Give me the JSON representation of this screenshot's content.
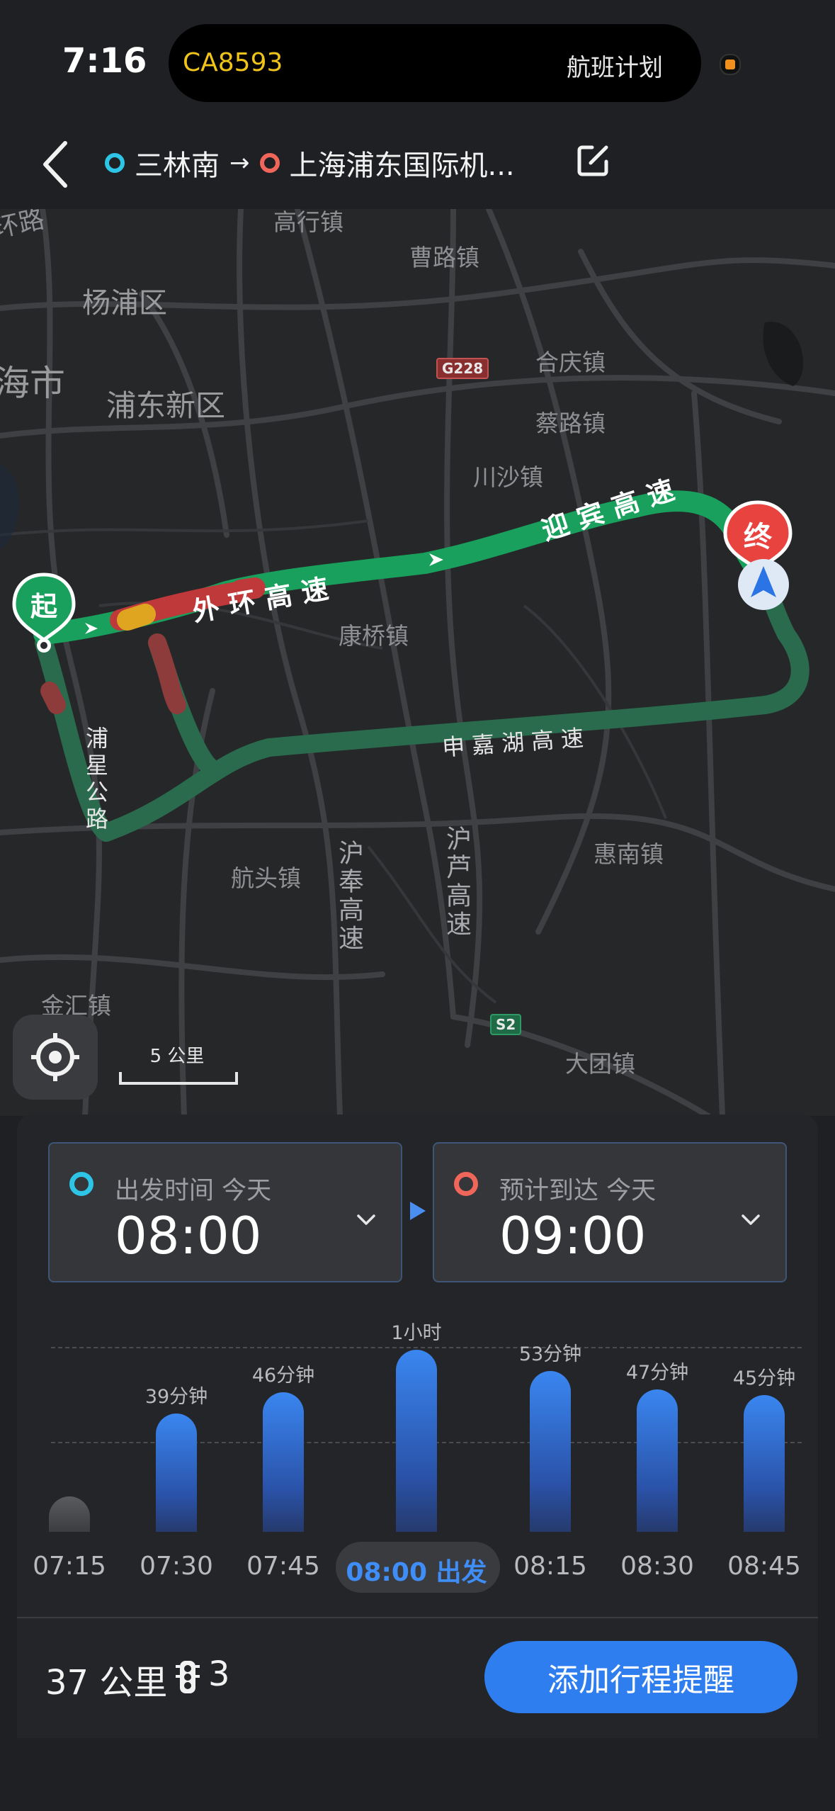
{
  "status": {
    "time": "7:16",
    "live_activity": {
      "flight_no": "CA8593",
      "label": "航班计划"
    }
  },
  "header": {
    "origin": "三林南",
    "arrow": "→",
    "destination": "上海浦东国际机...",
    "origin_color": "#2ec4e6",
    "destination_color": "#f0665a"
  },
  "map": {
    "places": [
      "环路",
      "高行镇",
      "杨浦区",
      "曹路镇",
      "海市",
      "浦东新区",
      "合庆镇",
      "蔡路镇",
      "川沙镇",
      "康桥镇",
      "惠南镇",
      "航头镇",
      "金汇镇",
      "大团镇"
    ],
    "roads": [
      "外环高速",
      "迎宾高速",
      "申嘉湖高速",
      "浦星公路",
      "沪奉高速",
      "沪芦高速"
    ],
    "road_badges": [
      "G228",
      "S2"
    ],
    "start_marker": "起",
    "end_marker": "终",
    "scale_label": "5 公里"
  },
  "departure": {
    "label": "出发时间 今天",
    "value": "08:00",
    "color": "#2ec4e6"
  },
  "arrival": {
    "label": "预计到达 今天",
    "value": "09:00",
    "color": "#f0665a"
  },
  "chart_data": {
    "type": "bar",
    "categories": [
      "07:15",
      "07:30",
      "07:45",
      "08:00",
      "08:15",
      "08:30",
      "08:45"
    ],
    "values": [
      null,
      39,
      46,
      60,
      53,
      47,
      45
    ],
    "value_labels": [
      "",
      "39分钟",
      "46分钟",
      "1小时",
      "53分钟",
      "47分钟",
      "45分钟"
    ],
    "unit": "分钟",
    "selected_index": 3,
    "selected_label": "08:00 出发",
    "colors": {
      "bar": "#3a86f0",
      "selected_text": "#3f8ef7"
    }
  },
  "footer": {
    "distance": "37 公里",
    "traffic_lights": "3",
    "add_reminder": "添加行程提醒"
  }
}
